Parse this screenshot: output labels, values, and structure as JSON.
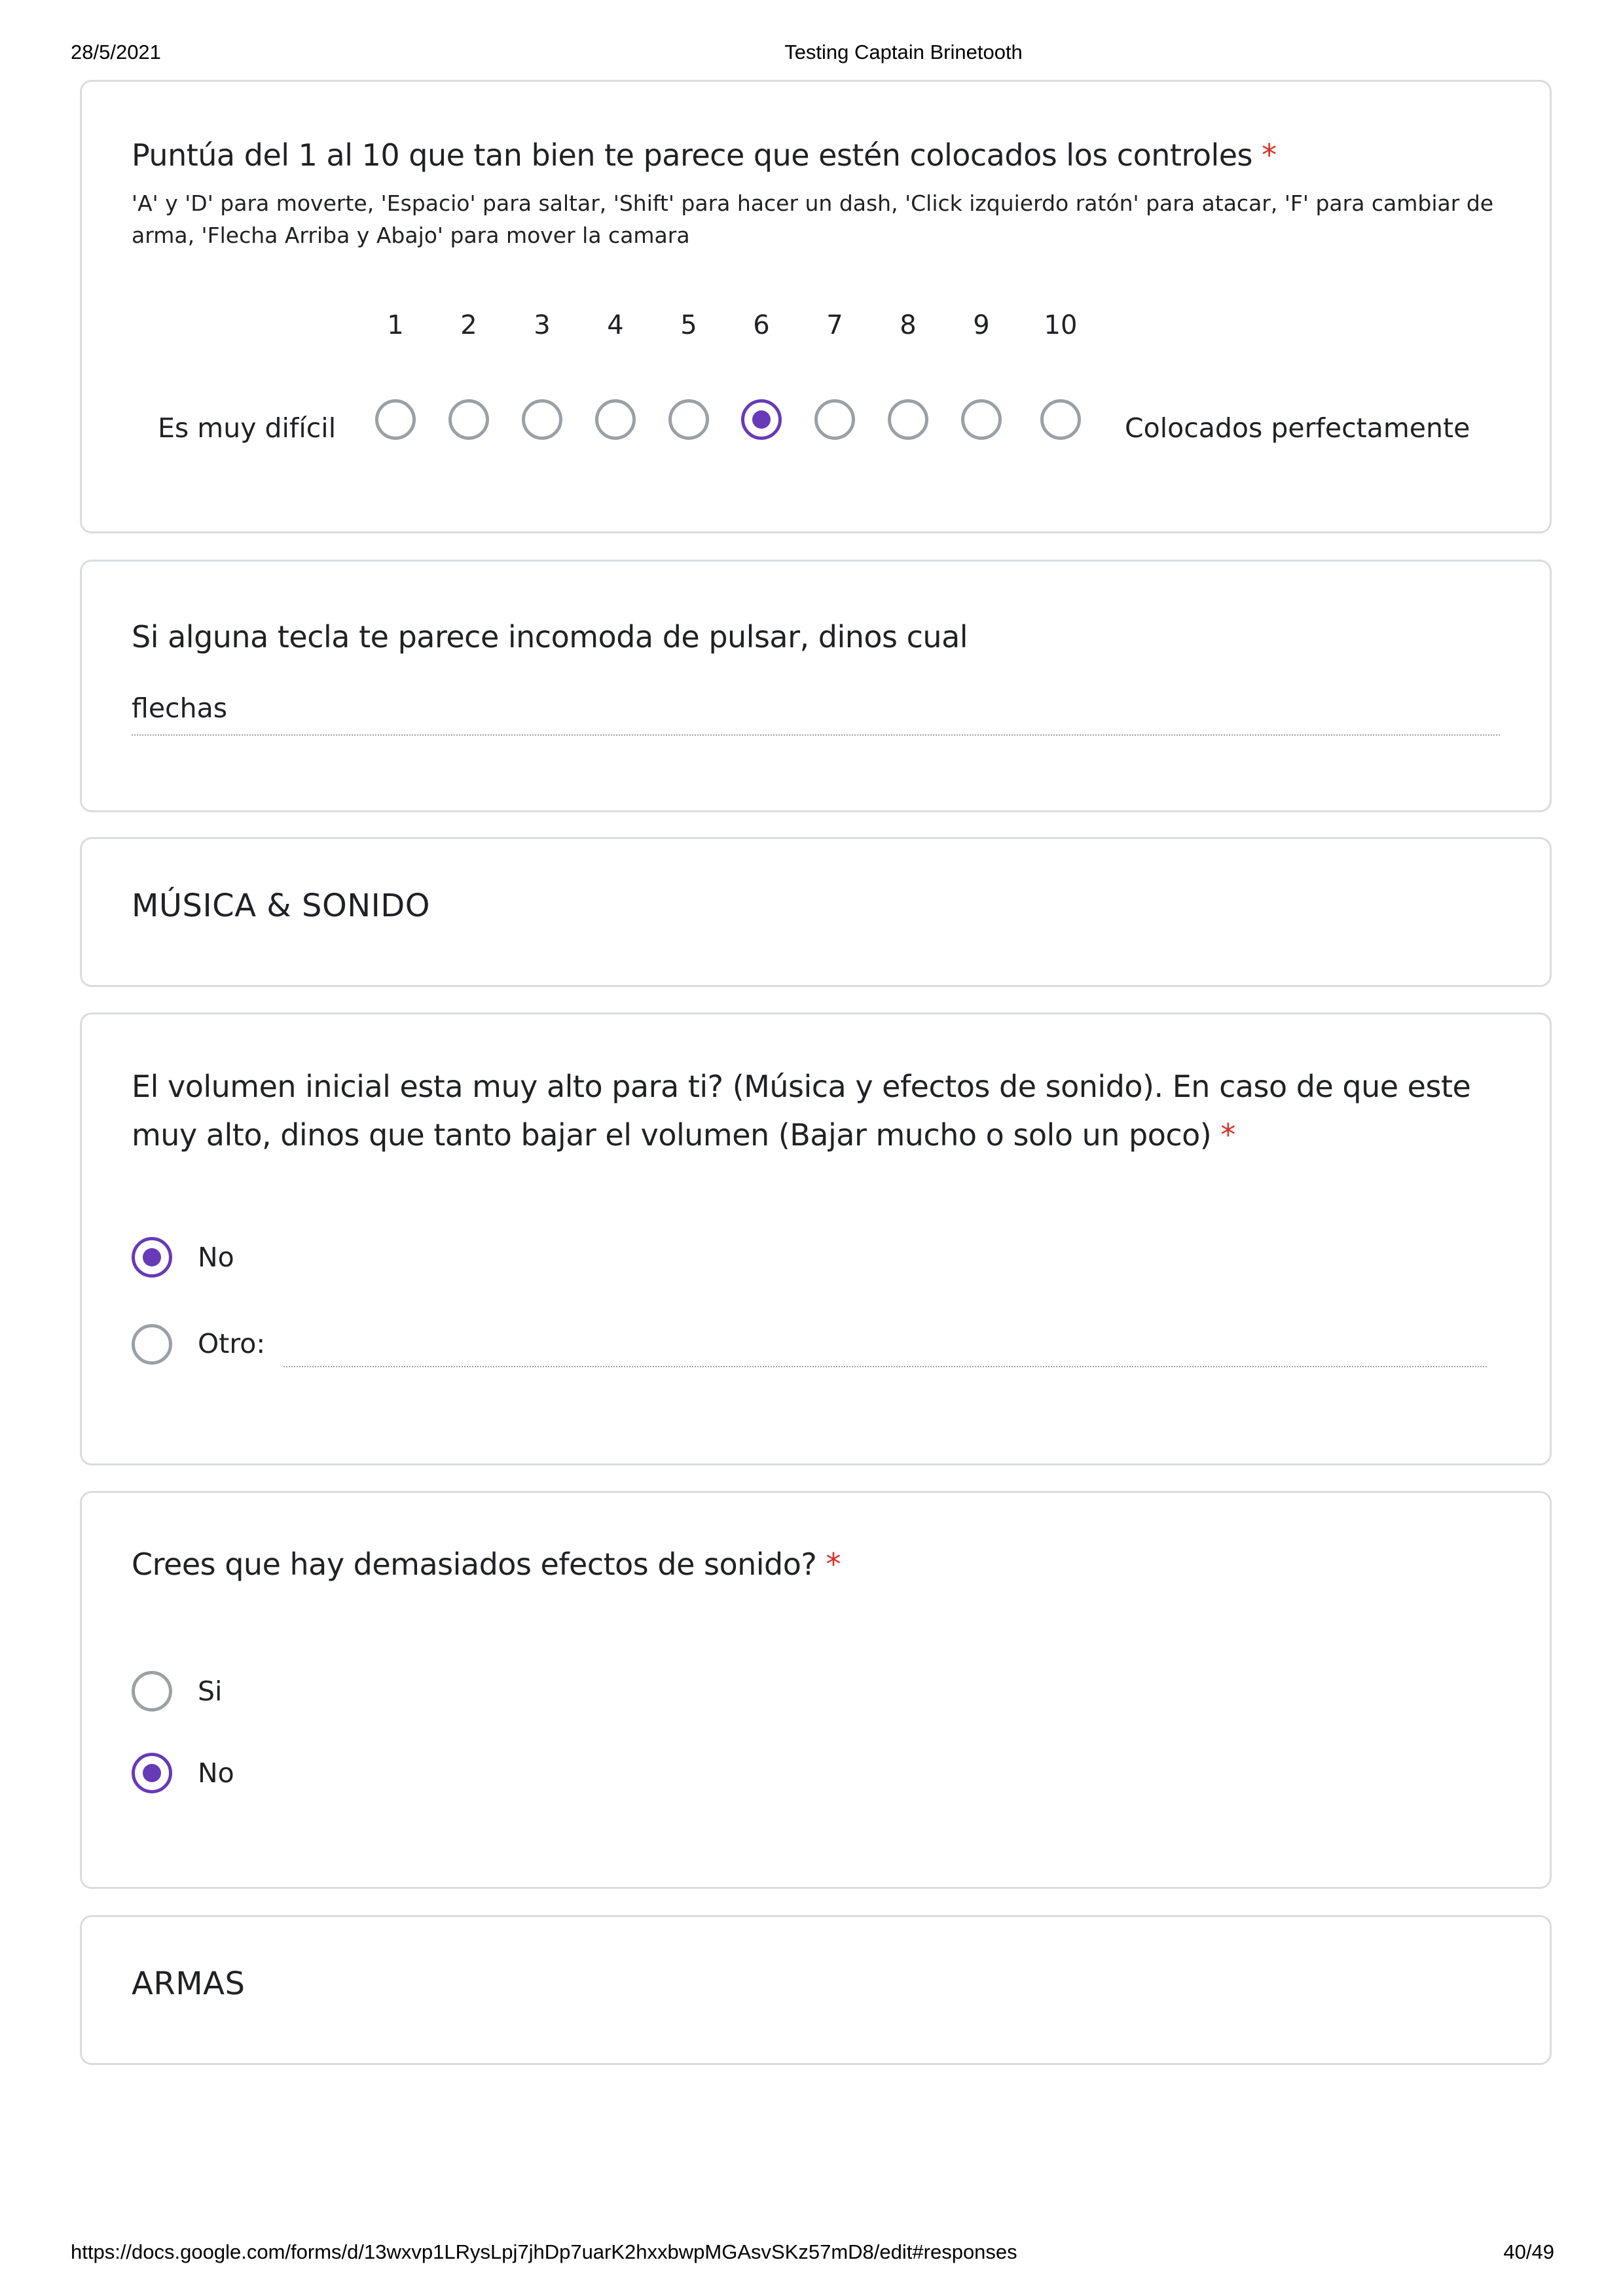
{
  "print_header": {
    "date": "28/5/2021",
    "title": "Testing Captain Brinetooth"
  },
  "print_footer": {
    "url": "https://docs.google.com/forms/d/13wxvp1LRysLpj7jhDp7uarK2hxxbwpMGAsvSKz57mD8/edit#responses",
    "page": "40/49"
  },
  "q_controls": {
    "title": "Puntúa del 1 al 10 que tan bien te parece que estén colocados los controles",
    "required_mark": "*",
    "description": "'A' y 'D' para moverte, 'Espacio' para saltar, 'Shift' para hacer un dash, 'Click izquierdo ratón' para atacar, 'F' para cambiar de arma, 'Flecha Arriba y Abajo' para mover la camara",
    "scale": [
      "1",
      "2",
      "3",
      "4",
      "5",
      "6",
      "7",
      "8",
      "9",
      "10"
    ],
    "selected_value": 6,
    "low_label": "Es muy difícil",
    "high_label": "Colocados perfectamente"
  },
  "q_keys": {
    "title": "Si alguna tecla te parece incomoda de pulsar, dinos cual",
    "answer": "flechas"
  },
  "section_music": {
    "title": "MÚSICA & SONIDO"
  },
  "q_volume": {
    "title_line1": "El volumen inicial esta muy alto para ti? (Música y efectos de sonido). En caso de que este",
    "title_line2": "muy alto, dinos que tanto bajar el volumen (Bajar mucho o solo un poco)",
    "required_mark": "*",
    "options": [
      "No",
      "Otro:"
    ],
    "selected": "No"
  },
  "q_effects": {
    "title": "Crees que hay demasiados efectos de sonido?",
    "required_mark": "*",
    "options": [
      "Si",
      "No"
    ],
    "selected": "No"
  },
  "section_weapons": {
    "title": "ARMAS"
  },
  "colors": {
    "accent": "#673ab7",
    "required": "#d93025",
    "border": "#dadce0",
    "radio_unchecked": "#9aa0a6"
  }
}
